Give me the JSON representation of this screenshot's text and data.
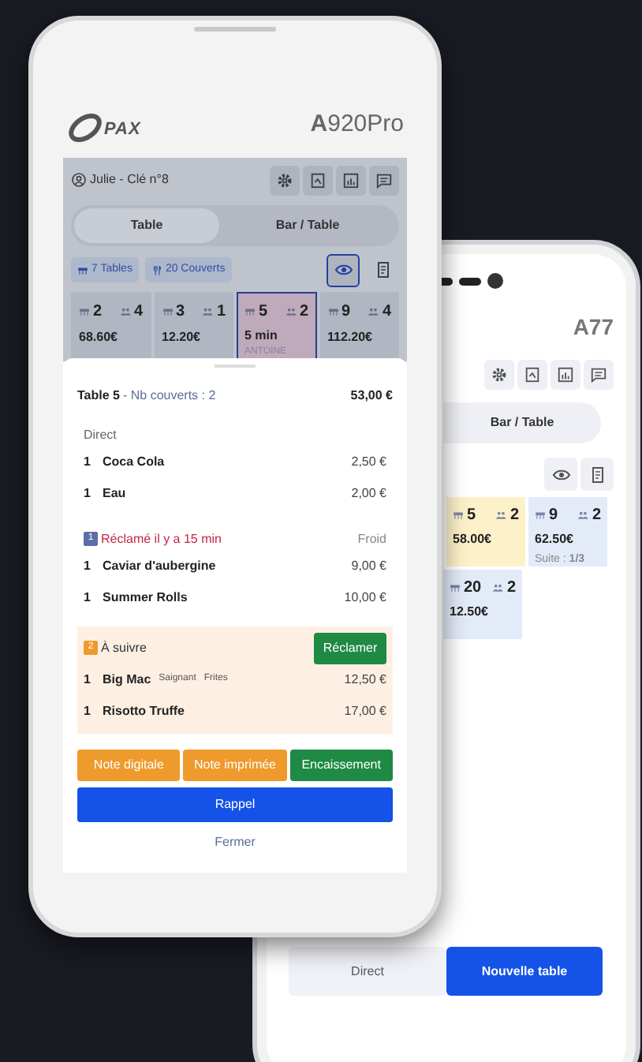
{
  "back_device": {
    "model": "A77",
    "tab": {
      "label": "Bar / Table",
      "selected": false
    },
    "tables": [
      {
        "number": "5",
        "guests": "2",
        "amount": "58.00€",
        "color": "#fdf1c9"
      },
      {
        "number": "9",
        "guests": "2",
        "amount": "62.50€",
        "suite": "Suite : **1/3**",
        "color": "#e4ebf8"
      },
      {
        "number": "20",
        "guests": "2",
        "amount": "12.50€",
        "color": "#e4ebf8"
      }
    ],
    "bottom_buttons": [
      {
        "label": "Direct",
        "kind": "secondary"
      },
      {
        "label": "Nouvelle table",
        "kind": "primary"
      }
    ]
  },
  "front_device": {
    "logo": "PAX",
    "model": "**A**920Pro",
    "app": {
      "user": "Julie - Clé n°8",
      "tabs": [
        {
          "label": "Table",
          "selected": true
        },
        {
          "label": "Bar / Table",
          "selected": false
        }
      ],
      "chips": [
        "7 Tables",
        "20 Couverts"
      ],
      "view_toggle": {
        "selected": true
      },
      "tables": [
        {
          "number": "2",
          "guests": "4",
          "amount": "68.60€",
          "selected": false
        },
        {
          "number": "3",
          "guests": "1",
          "amount": "12.20€",
          "selected": false
        },
        {
          "number": "5",
          "guests": "2",
          "time": "5 min",
          "waiter": "ANTOINE",
          "selected": true
        },
        {
          "number": "9",
          "guests": "4",
          "amount": "112.20€",
          "selected": false
        }
      ],
      "order_sheet": {
        "title": "Table 5",
        "subtitle": "- Nb couverts : 2",
        "total": "53,00 €",
        "sections": [
          {
            "kind": "plain",
            "title": "Direct",
            "items": [
              {
                "qty": "1",
                "name": "Coca Cola",
                "price": "2,50 €"
              },
              {
                "qty": "1",
                "name": "Eau",
                "price": "2,00 €"
              }
            ]
          },
          {
            "kind": "claimed",
            "badge": "1",
            "title": "Réclamé il y a 15 min",
            "note": "Froid",
            "items": [
              {
                "qty": "1",
                "name": "Caviar d'aubergine",
                "price": "9,00 €"
              },
              {
                "qty": "1",
                "name": "Summer Rolls",
                "price": "10,00 €"
              }
            ]
          },
          {
            "kind": "next",
            "badge": "2",
            "title": "À suivre",
            "action": "Réclamer",
            "items": [
              {
                "qty": "1",
                "name": "Big Mac",
                "options": [
                  "Saignant",
                  "Frites"
                ],
                "price": "12,50 €"
              },
              {
                "qty": "1",
                "name": "Risotto Truffe",
                "price": "17,00 €"
              }
            ]
          }
        ],
        "actions": [
          {
            "label": "Note digitale",
            "kind": "warning"
          },
          {
            "label": "Note imprimée",
            "kind": "warning"
          },
          {
            "label": "Encaissement",
            "kind": "success"
          },
          {
            "label": "Rappel",
            "kind": "primary"
          },
          {
            "label": "Fermer",
            "kind": "link"
          }
        ]
      }
    }
  }
}
